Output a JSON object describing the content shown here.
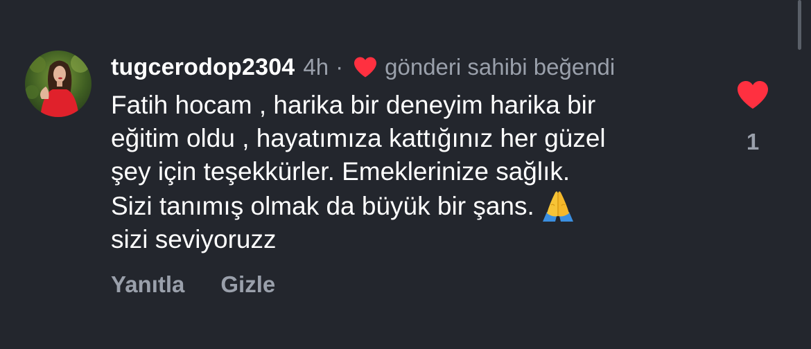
{
  "comment": {
    "username": "tugcerodop2304",
    "time": "4h",
    "separator": "·",
    "author_liked_text": "gönderi sahibi beğendi",
    "author_liked_icon": "heart-icon",
    "lines": [
      "Fatih hocam , harika bir deneyim harika bir",
      "eğitim oldu , hayatımıza kattığınız her güzel",
      "şey için teşekkürler. Emeklerinize sağlık.",
      "Sizi tanımış olmak da büyük bir şans.",
      "sizi seviyoruzz"
    ],
    "emoji": "folded-hands-icon",
    "like_count": "1",
    "like_icon": "heart-icon"
  },
  "actions": {
    "reply_label": "Yanıtla",
    "hide_label": "Gizle"
  },
  "colors": {
    "background": "#23262d",
    "heart": "#ff3040",
    "secondary_text": "#9aa0ab",
    "primary_text": "#ffffff"
  }
}
